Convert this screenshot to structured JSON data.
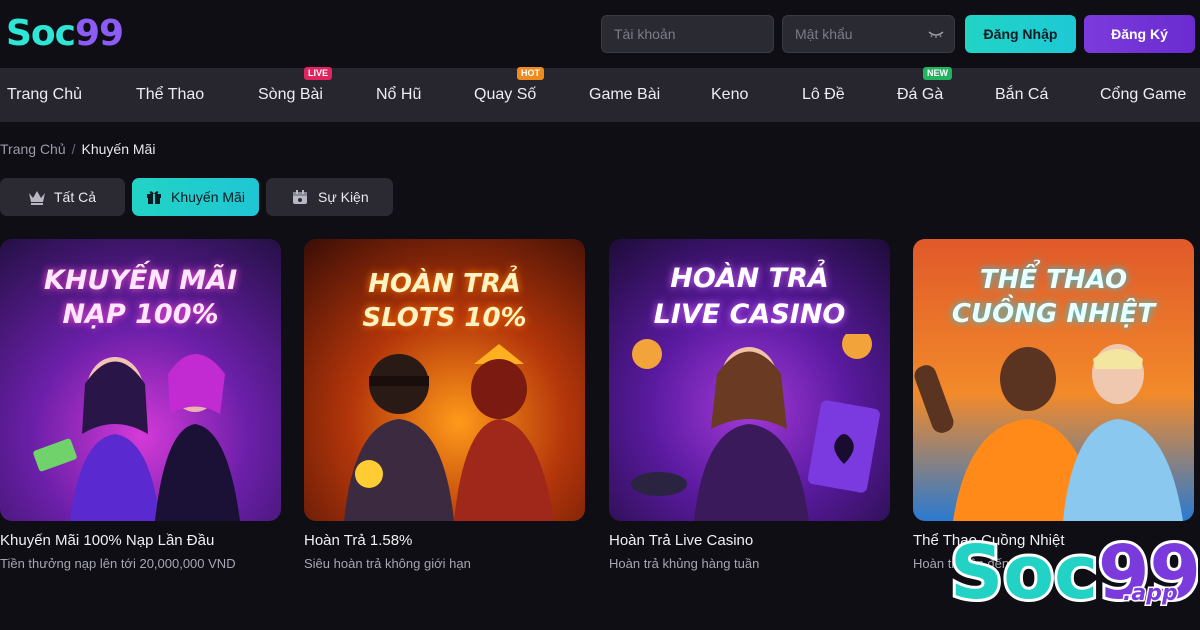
{
  "header": {
    "logo_part1": "Soc",
    "logo_part2": "99",
    "username_placeholder": "Tài khoản",
    "password_placeholder": "Mật khẩu",
    "login_label": "Đăng Nhập",
    "register_label": "Đăng Ký"
  },
  "nav": {
    "items": [
      {
        "label": "Trang Chủ"
      },
      {
        "label": "Thể Thao"
      },
      {
        "label": "Sòng Bài",
        "badge": "LIVE",
        "badge_color": "#e0245e"
      },
      {
        "label": "Nổ Hũ"
      },
      {
        "label": "Quay Số",
        "badge": "HOT",
        "badge_color": "#f08a1c"
      },
      {
        "label": "Game Bài"
      },
      {
        "label": "Keno"
      },
      {
        "label": "Lô Đề"
      },
      {
        "label": "Đá Gà",
        "badge": "NEW",
        "badge_color": "#22b35e"
      },
      {
        "label": "Bắn Cá"
      },
      {
        "label": "Cổng Game"
      }
    ]
  },
  "breadcrumb": {
    "home": "Trang Chủ",
    "sep": "/",
    "current": "Khuyến Mãi"
  },
  "tabs": [
    {
      "label": "Tất Cả",
      "icon": "crown-icon"
    },
    {
      "label": "Khuyến Mãi",
      "icon": "gift-icon",
      "active": true
    },
    {
      "label": "Sự Kiện",
      "icon": "calendar-icon"
    }
  ],
  "cards": [
    {
      "banner_line1": "KHUYẾN MÃI",
      "banner_line2": "NẠP 100%",
      "title": "Khuyến Mãi 100% Nạp Lần Đầu",
      "subtitle": "Tiền thưởng nạp lên tới 20,000,000 VND"
    },
    {
      "banner_line1": "HOÀN TRẢ",
      "banner_line2": "SLOTS 10%",
      "title": "Hoàn Trả 1.58%",
      "subtitle": "Siêu hoàn trả không giới hạn"
    },
    {
      "banner_line1": "HOÀN TRẢ",
      "banner_line2": "LIVE CASINO",
      "title": "Hoàn Trả Live Casino",
      "subtitle": "Hoàn trả khủng hàng tuần"
    },
    {
      "banner_line1": "THỂ THAO",
      "banner_line2": "CUỒNG NHIỆT",
      "title": "Thể Thao Cuồng Nhiệt",
      "subtitle": "Hoàn trả lên đến 1.6%"
    }
  ],
  "watermark": {
    "text1": "Soc",
    "text2": "99",
    "domain": ".app"
  },
  "colors": {
    "accent_cyan": "#22d3c5",
    "accent_purple": "#7b3bdc",
    "bg": "#0f0e14",
    "nav_bg": "#27262e"
  }
}
